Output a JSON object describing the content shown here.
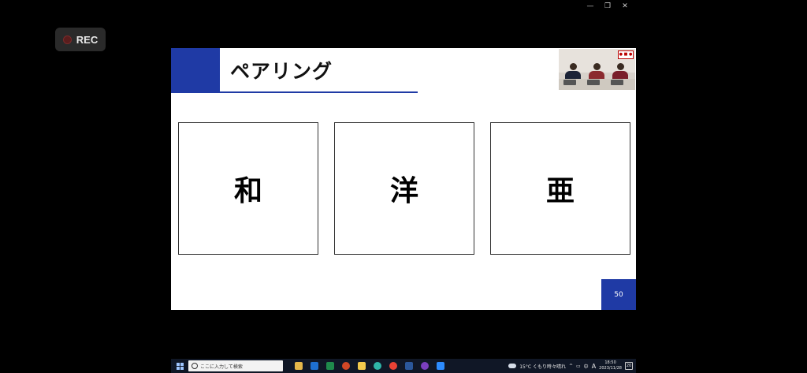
{
  "window": {
    "minimize_glyph": "—",
    "maximize_glyph": "❐",
    "close_glyph": "✕"
  },
  "recording": {
    "label": "REC",
    "icon": "record-dot-icon"
  },
  "slide": {
    "title": "ペアリング",
    "accent_color": "#1f3aa5",
    "cards": [
      {
        "label": "和"
      },
      {
        "label": "洋"
      },
      {
        "label": "亜"
      }
    ],
    "page_number": "50",
    "video_tile_sign": "● ■ ●"
  },
  "taskbar": {
    "search_placeholder": "ここに入力して検索",
    "apps": [
      {
        "name": "file-explorer",
        "color": "#e6b84a"
      },
      {
        "name": "outlook",
        "color": "#1e6fd0"
      },
      {
        "name": "excel",
        "color": "#1f8a4c"
      },
      {
        "name": "powerpoint",
        "color": "#d24726"
      },
      {
        "name": "file-folder",
        "color": "#f2c94c"
      },
      {
        "name": "edge",
        "color": "#2fb5a8"
      },
      {
        "name": "chrome",
        "color": "#e94235"
      },
      {
        "name": "word",
        "color": "#2b579a"
      },
      {
        "name": "media-player",
        "color": "#7b3fbf"
      },
      {
        "name": "zoom",
        "color": "#2d8cff"
      }
    ],
    "weather": "15°C くもり時々晴れ",
    "ime_mode": "A",
    "ime_lang": "中",
    "time": "18:50",
    "date": "2023/11/28",
    "notification_count": "20"
  }
}
